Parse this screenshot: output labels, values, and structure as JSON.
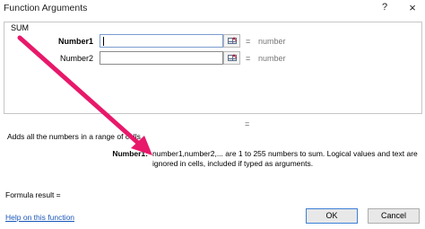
{
  "window": {
    "title": "Function Arguments",
    "help_icon": "?",
    "close_icon": "×"
  },
  "function_name": "SUM",
  "arguments": [
    {
      "label": "Number1",
      "value": "",
      "hint": "number",
      "equals": "="
    },
    {
      "label": "Number2",
      "value": "",
      "hint": "number",
      "equals": "="
    }
  ],
  "result_equals": "=",
  "description": "Adds all the numbers in a range of cells.",
  "argument_help": {
    "label": "Number1:",
    "text": "number1,number2,... are 1 to 255 numbers to sum. Logical values and text are ignored in cells, included if typed as arguments."
  },
  "formula_result": "Formula result =",
  "help_link": "Help on this function",
  "buttons": {
    "ok": "OK",
    "cancel": "Cancel"
  },
  "colors": {
    "annotation_arrow": "#e8186a",
    "link": "#1a56b8"
  }
}
